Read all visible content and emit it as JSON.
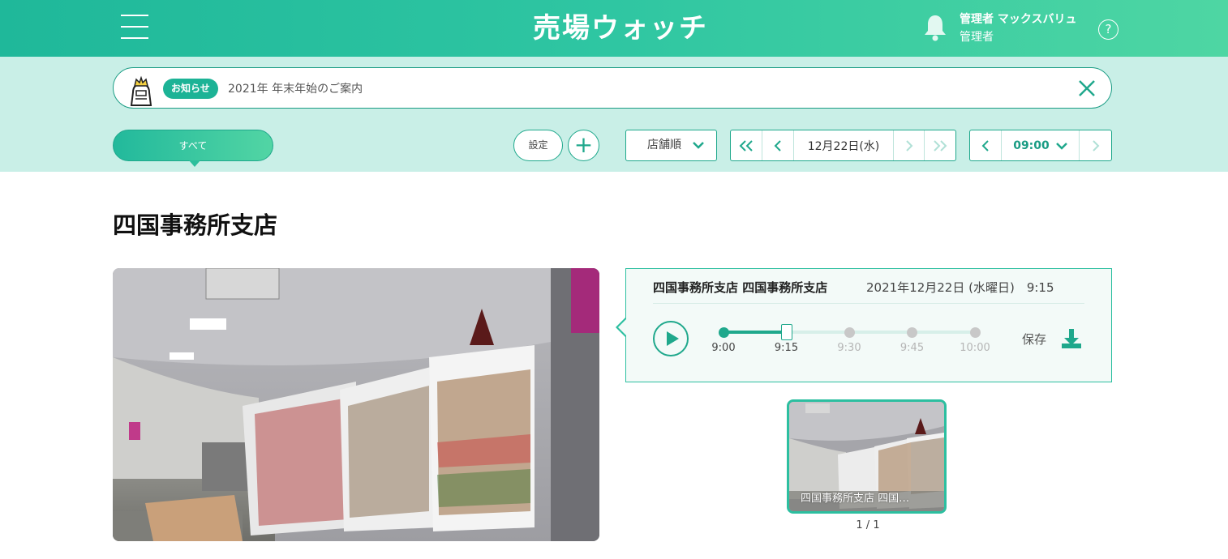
{
  "header": {
    "logo": "売場ウォッチ",
    "user_name": "管理者 マックスバリュ",
    "user_role": "管理者",
    "help_label": "?"
  },
  "notice": {
    "badge": "お知らせ",
    "text": "2021年 年末年始のご案内"
  },
  "toolbar": {
    "tab_all_label": "すべて",
    "settings_label": "設定",
    "add_label": "+",
    "sort_label": "店舗順",
    "date_label": "12月22日(水)",
    "time_label": "09:00"
  },
  "main": {
    "page_title": "四国事務所支店",
    "info": {
      "store": "四国事務所支店 四国事務所支店",
      "datetime": "2021年12月22日 (水曜日)　9:15",
      "save_label": "保存",
      "timeline": [
        {
          "label": "9:00",
          "state": "active"
        },
        {
          "label": "9:15",
          "state": "current"
        },
        {
          "label": "9:30",
          "state": "inactive"
        },
        {
          "label": "9:45",
          "state": "inactive"
        },
        {
          "label": "10:00",
          "state": "inactive"
        }
      ],
      "progress": 0.25
    },
    "thumbnail": {
      "label": "四国事務所支店 四国…"
    },
    "pager": "1 / 1"
  },
  "colors": {
    "brand": "#1fb89a",
    "accent": "#1fa88c",
    "band": "#c9efe7"
  }
}
